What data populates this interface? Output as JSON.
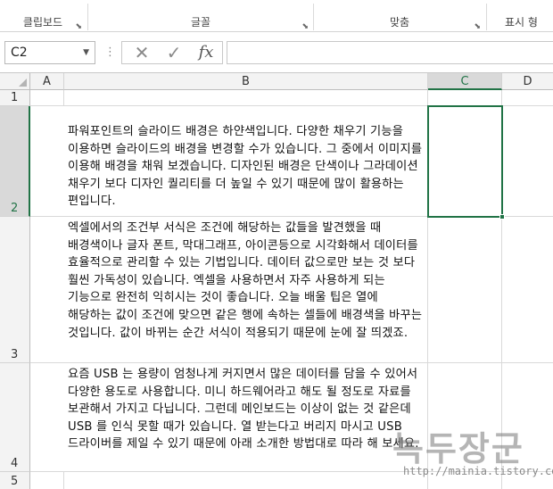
{
  "ribbon": {
    "groups": [
      {
        "label": "클립보드"
      },
      {
        "label": "글꼴"
      },
      {
        "label": "맞춤"
      },
      {
        "label": "표시 형"
      }
    ]
  },
  "formula_bar": {
    "name_box": "C2",
    "cancel_glyph": "✕",
    "enter_glyph": "✓",
    "fx_label": "fx",
    "formula": ""
  },
  "columns": [
    "A",
    "B",
    "C",
    "D"
  ],
  "rows": [
    "1",
    "2",
    "3",
    "4",
    "5"
  ],
  "selected_cell": "C2",
  "cells": {
    "B2": "파워포인트의 슬라이드 배경은 하얀색입니다. 다양한 채우기 기능을 이용하면 슬라이드의 배경을 변경할 수가 있습니다. 그 중에서 이미지를 이용해 배경을 채워 보겠습니다. 디자인된 배경은 단색이나 그라데이션 채우기 보다 디자인 퀄리티를 더 높일 수 있기 때문에 많이 활용하는 편입니다.",
    "B3": "엑셀에서의 조건부 서식은 조건에 해당하는 값들을 발견했을 때 배경색이나 글자 폰트, 막대그래프, 아이콘등으로 시각화해서 데이터를 효율적으로 관리할 수 있는 기법입니다. 데이터 값으로만 보는 것 보다 훨씬 가독성이 있습니다. 엑셀을 사용하면서 자주 사용하게 되는 기능으로 완전히 익히시는 것이 좋습니다. 오늘 배울 팁은 열에 해당하는 값이 조건에 맞으면 같은 행에 속하는 셀들에 배경색을 바꾸는 것입니다. 값이 바뀌는 순간 서식이 적용되기 때문에 눈에 잘 띄겠죠.",
    "B4": "요즘 USB 는 용량이 엄청나게 커지면서 많은 데이터를 담을 수 있어서 다양한 용도로 사용합니다. 미니 하드웨어라고 해도 될 정도로 자료를 보관해서 가지고 다닙니다. 그런데 메인보드는 이상이 없는 것 같은데 USB 를 인식 못할 때가 있습니다. 열 받는다고 버리지 마시고 USB 드라이버를 제일 수 있기 때문에 아래 소개한 방법대로 따라 해 보세요."
  },
  "watermark": {
    "text": "녹두장군",
    "url": "http://mainia.tistory.com"
  },
  "colors": {
    "accent": "#217346",
    "header_bg": "#f3f3f3",
    "gridline": "#d9d9d9"
  }
}
